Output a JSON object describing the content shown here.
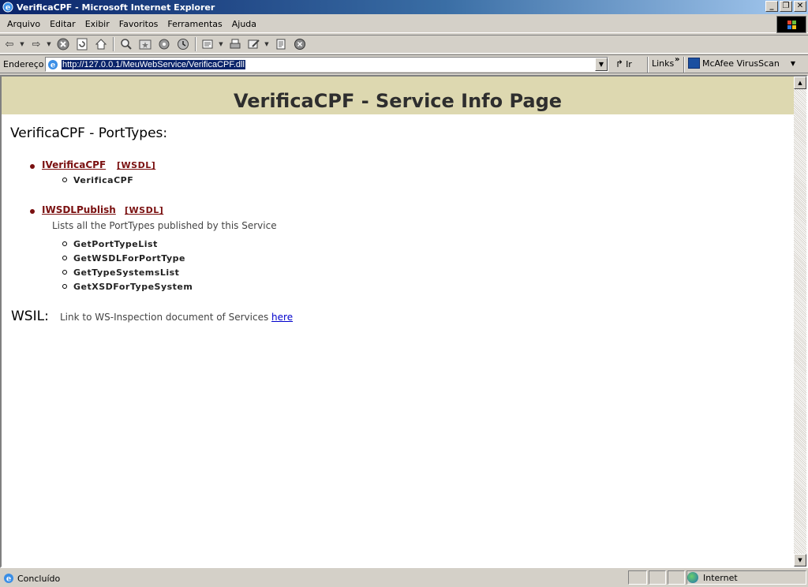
{
  "window": {
    "title": "VerificaCPF - Microsoft Internet Explorer",
    "buttons": {
      "minimize": "_",
      "maximize": "❐",
      "close": "✕"
    }
  },
  "menu": [
    "Arquivo",
    "Editar",
    "Exibir",
    "Favoritos",
    "Ferramentas",
    "Ajuda"
  ],
  "toolbar": {
    "icons": [
      "back-icon",
      "forward-icon",
      "stop-icon",
      "refresh-icon",
      "home-icon",
      "search-icon",
      "favorites-icon",
      "media-icon",
      "history-icon",
      "mail-icon",
      "print-icon",
      "edit-icon",
      "discuss-icon",
      "messenger-icon"
    ]
  },
  "address": {
    "label": "Endereço",
    "url": "http://127.0.0.1/MeuWebService/VerificaCPF.dll",
    "go_label": "Ir",
    "links_label": "Links",
    "chevron": "»",
    "mcafee_label": "McAfee VirusScan"
  },
  "page": {
    "heading": "VerificaCPF - Service Info Page",
    "porttypes_title": "VerificaCPF - PortTypes:",
    "interfaces": [
      {
        "name": "IVerificaCPF",
        "wsdl": "[WSDL]",
        "methods": [
          "VerificaCPF"
        ]
      },
      {
        "name": "IWSDLPublish",
        "wsdl": "[WSDL]",
        "description": "Lists all the PortTypes published by this Service",
        "methods": [
          "GetPortTypeList",
          "GetWSDLForPortType",
          "GetTypeSystemsList",
          "GetXSDForTypeSystem"
        ]
      }
    ],
    "wsil": {
      "label": "WSIL:",
      "text": "Link to WS-Inspection document of Services",
      "link": "here"
    }
  },
  "status": {
    "text": "Concluído",
    "zone": "Internet"
  },
  "colors": {
    "banner": "#ddd8b0",
    "link_maroon": "#7a1010",
    "link_blue": "#0000cc",
    "titlebar_start": "#0a246a"
  }
}
